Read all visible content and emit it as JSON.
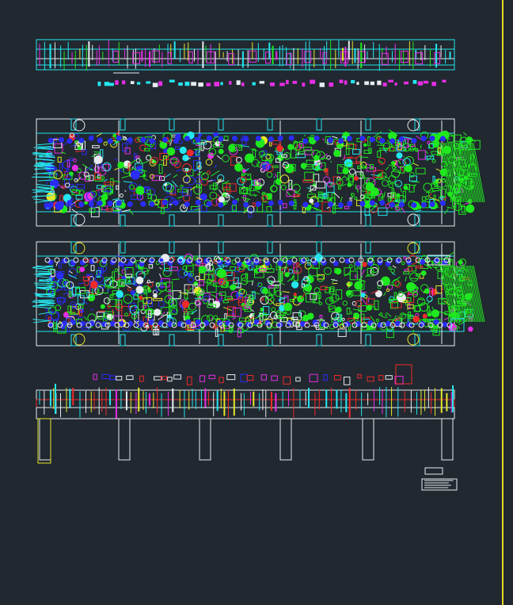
{
  "canvas": {
    "background": "#212830",
    "sheet_border_color": "#e6d92a"
  },
  "palette": {
    "cyan": "#25e6ee",
    "green": "#1fe81f",
    "blue": "#2a2cf5",
    "white": "#e8ecef",
    "magenta": "#e62ee6",
    "red": "#ee2a2a",
    "yellow": "#e6e62a"
  },
  "views": [
    {
      "id": "top-strip",
      "kind": "elevation",
      "name": "strip-layout-view"
    },
    {
      "id": "upper-plate",
      "kind": "plan",
      "name": "upper-die-plan-view"
    },
    {
      "id": "lower-plate",
      "kind": "plan",
      "name": "lower-die-plan-view"
    },
    {
      "id": "section",
      "kind": "section",
      "name": "die-section-view"
    }
  ],
  "title_block": {
    "name": "title-block"
  }
}
